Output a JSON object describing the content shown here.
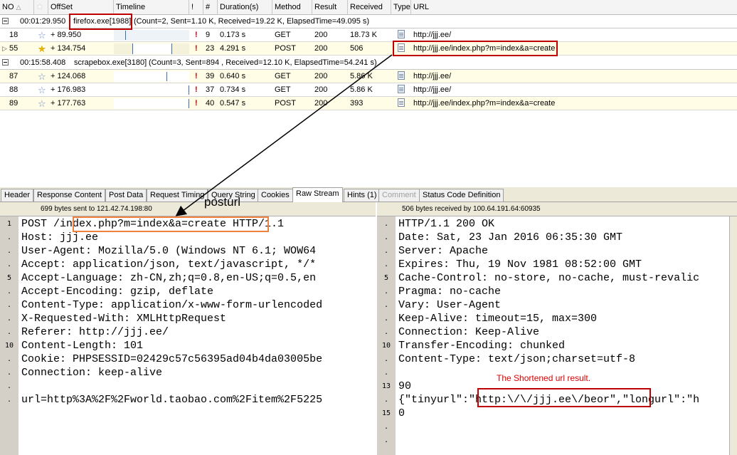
{
  "columns": [
    "NO",
    "",
    "OffSet",
    "Timeline",
    "!",
    "#",
    "Duration(s)",
    "Method",
    "Result",
    "Received",
    "Type",
    "URL"
  ],
  "groups": [
    {
      "time": "00:01:29.950",
      "process": "firefox.exe[1988]",
      "stats": "(Count=2, Sent=1.10 K, Received=19.22 K, ElapsedTime=49.095 s)"
    },
    {
      "time": "00:15:58.408",
      "process": "scrapebox.exe[3180]",
      "stats": "(Count=3, Sent=894 , Received=12.10 K, ElapsedTime=54.241 s)"
    }
  ],
  "rows": [
    {
      "no": "18",
      "offset": "+ 89.950",
      "bang": "!",
      "num": "9",
      "duration": "0.173 s",
      "method": "GET",
      "result": "200",
      "received": "18.73 K",
      "url": "http://jjj.ee/",
      "starred": false
    },
    {
      "no": "55",
      "offset": "+ 134.754",
      "bang": "!",
      "num": "23",
      "duration": "4.291 s",
      "method": "POST",
      "result": "200",
      "received": "506",
      "url": "http://jjj.ee/index.php?m=index&a=create",
      "starred": true
    },
    {
      "no": "87",
      "offset": "+ 124.068",
      "bang": "!",
      "num": "39",
      "duration": "0.640 s",
      "method": "GET",
      "result": "200",
      "received": "5.86 K",
      "url": "http://jjj.ee/",
      "starred": false
    },
    {
      "no": "88",
      "offset": "+ 176.983",
      "bang": "!",
      "num": "37",
      "duration": "0.734 s",
      "method": "GET",
      "result": "200",
      "received": "5.86 K",
      "url": "http://jjj.ee/",
      "starred": false
    },
    {
      "no": "89",
      "offset": "+ 177.763",
      "bang": "!",
      "num": "40",
      "duration": "0.547 s",
      "method": "POST",
      "result": "200",
      "received": "393",
      "url": "http://jjj.ee/index.php?m=index&a=create",
      "starred": false
    }
  ],
  "tabs": [
    "Header",
    "Response Content",
    "Post Data",
    "Request Timing",
    "Query String",
    "Cookies",
    "Raw Stream",
    "Hints (1)",
    "Comment",
    "Status Code Definition"
  ],
  "active_tab": "Raw Stream",
  "annotation_posturl": "posturl",
  "annotation_result": "The Shortened url result.",
  "request": {
    "info": "699 bytes sent to 121.42.74.198:80",
    "line_numbers": [
      "1",
      ".",
      ".",
      ".",
      "5",
      ".",
      ".",
      ".",
      ".",
      "10",
      ".",
      ".",
      ".",
      "."
    ],
    "lines": [
      "POST /index.php?m=index&a=create HTTP/1.1",
      "Host: jjj.ee",
      "User-Agent: Mozilla/5.0 (Windows NT 6.1; WOW64",
      "Accept: application/json, text/javascript, */*",
      "Accept-Language: zh-CN,zh;q=0.8,en-US;q=0.5,en",
      "Accept-Encoding: gzip, deflate",
      "Content-Type: application/x-www-form-urlencoded",
      "X-Requested-With: XMLHttpRequest",
      "Referer: http://jjj.ee/",
      "Content-Length: 101",
      "Cookie: PHPSESSID=02429c57c56395ad04b4da03005be",
      "Connection: keep-alive",
      "",
      "url=http%3A%2F%2Fworld.taobao.com%2Fitem%2F5225"
    ]
  },
  "response": {
    "info": "506 bytes received by 100.64.191.64:60935",
    "line_numbers": [
      ".",
      ".",
      ".",
      ".",
      "5",
      ".",
      ".",
      ".",
      ".",
      "10",
      ".",
      ".",
      "13",
      ".",
      "15",
      ".",
      "."
    ],
    "lines": [
      "HTTP/1.1 200 OK",
      "Date: Sat, 23 Jan 2016 06:35:30 GMT",
      "Server: Apache",
      "Expires: Thu, 19 Nov 1981 08:52:00 GMT",
      "Cache-Control: no-store, no-cache, must-revalic",
      "Pragma: no-cache",
      "Vary: User-Agent",
      "Keep-Alive: timeout=15, max=300",
      "Connection: Keep-Alive",
      "Transfer-Encoding: chunked",
      "Content-Type: text/json;charset=utf-8",
      "",
      "90",
      "{\"tinyurl\":\"http:\\/\\/jjj.ee\\/beor\",\"longurl\":\"h",
      "0",
      "",
      ""
    ]
  }
}
